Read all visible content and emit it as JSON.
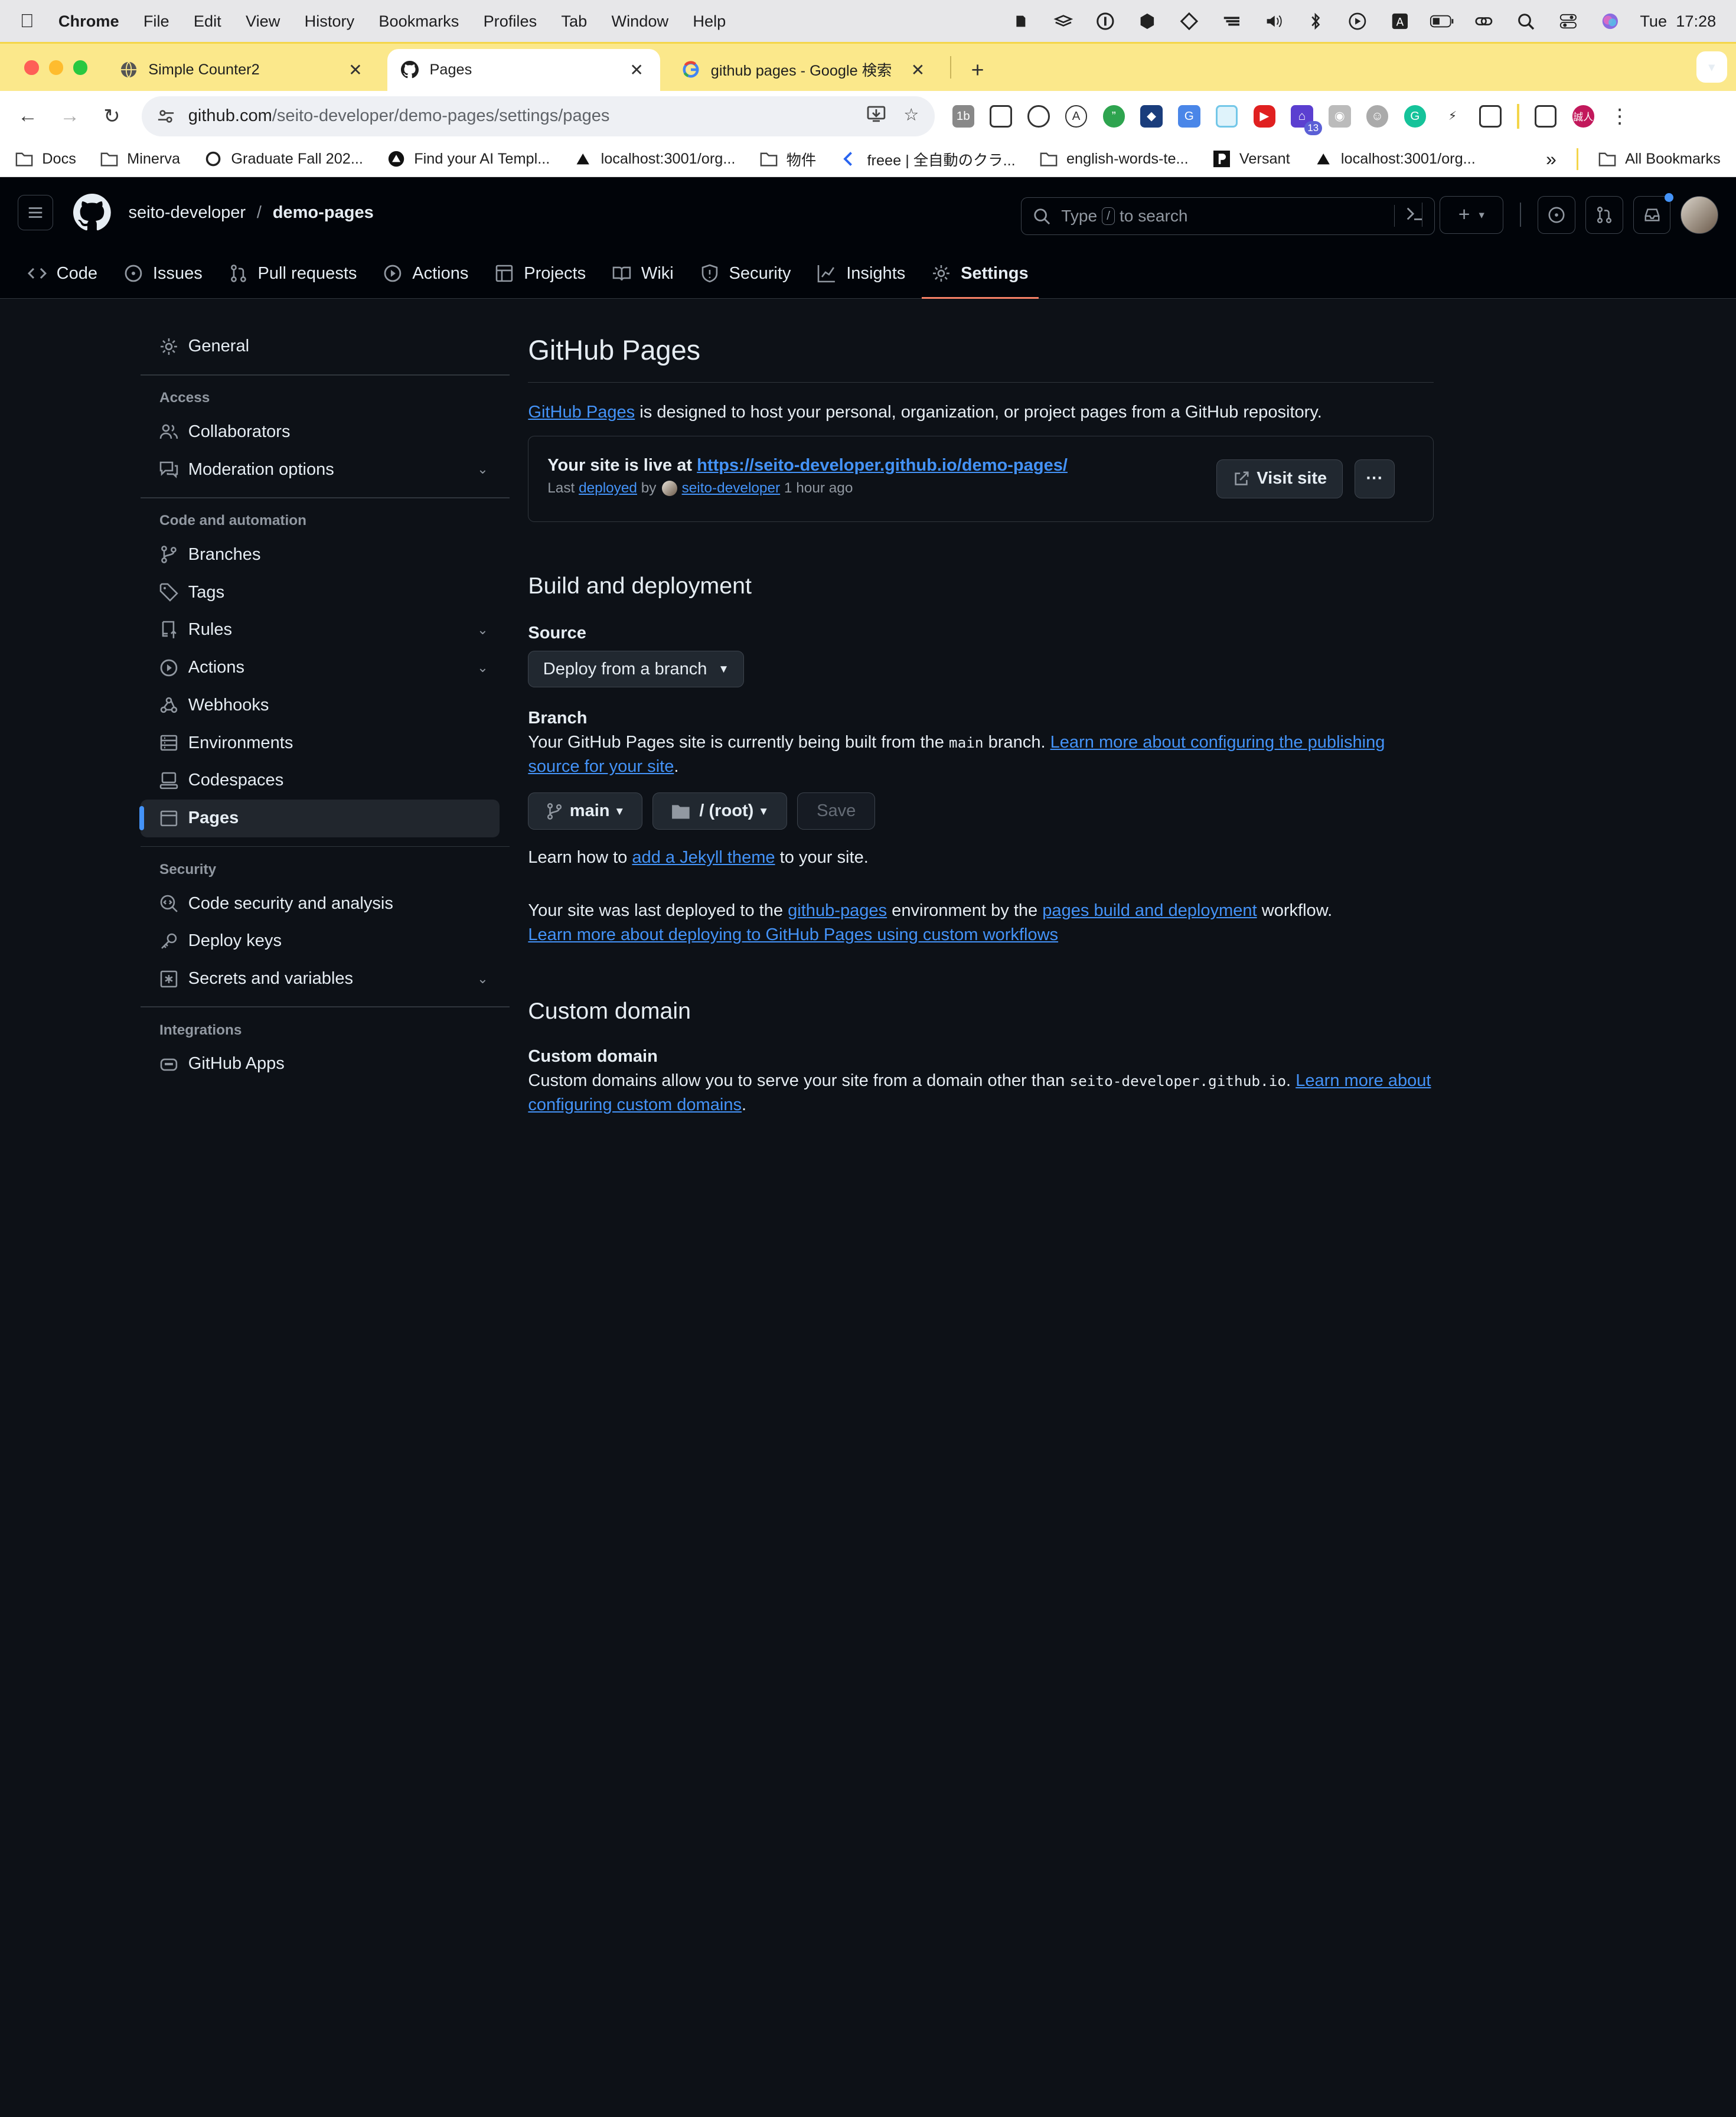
{
  "menubar": {
    "app": "Chrome",
    "items": [
      "File",
      "Edit",
      "View",
      "History",
      "Bookmarks",
      "Profiles",
      "Tab",
      "Window",
      "Help"
    ],
    "clock": "Tue  17:28"
  },
  "tabs": [
    {
      "title": "Simple Counter2",
      "icon": "globe-icon"
    },
    {
      "title": "Pages",
      "icon": "github-icon"
    },
    {
      "title": "github pages - Google 検索",
      "icon": "google-icon"
    }
  ],
  "url": {
    "host": "github.com",
    "path": "/seito-developer/demo-pages/settings/pages"
  },
  "extensions": {
    "badge_count": "13",
    "avatar_text": "誠人"
  },
  "bookmarks": {
    "items": [
      "Docs",
      "Minerva",
      "Graduate Fall 202...",
      "Find your AI Templ...",
      "localhost:3001/org...",
      "物件",
      "freee | 全自動のクラ...",
      "english-words-te...",
      "Versant",
      "localhost:3001/org..."
    ],
    "overflow": "»",
    "all": "All Bookmarks"
  },
  "github": {
    "owner": "seito-developer",
    "separator": "/",
    "repo": "demo-pages",
    "search": {
      "prefix": "Type",
      "key": "/",
      "suffix": "to search"
    },
    "tabs": [
      "Code",
      "Issues",
      "Pull requests",
      "Actions",
      "Projects",
      "Wiki",
      "Security",
      "Insights",
      "Settings"
    ]
  },
  "sidebar": {
    "general": "General",
    "sections": [
      {
        "heading": "Access",
        "items": [
          {
            "label": "Collaborators"
          },
          {
            "label": "Moderation options",
            "expand": true
          }
        ]
      },
      {
        "heading": "Code and automation",
        "items": [
          {
            "label": "Branches"
          },
          {
            "label": "Tags"
          },
          {
            "label": "Rules",
            "expand": true
          },
          {
            "label": "Actions",
            "expand": true
          },
          {
            "label": "Webhooks"
          },
          {
            "label": "Environments"
          },
          {
            "label": "Codespaces"
          },
          {
            "label": "Pages",
            "active": true
          }
        ]
      },
      {
        "heading": "Security",
        "items": [
          {
            "label": "Code security and analysis"
          },
          {
            "label": "Deploy keys"
          },
          {
            "label": "Secrets and variables",
            "expand": true
          }
        ]
      },
      {
        "heading": "Integrations",
        "items": [
          {
            "label": "GitHub Apps"
          }
        ]
      }
    ]
  },
  "pages": {
    "title": "GitHub Pages",
    "intro_link": "GitHub Pages",
    "intro_rest": " is designed to host your personal, organization, or project pages from a GitHub repository.",
    "live": {
      "prefix": "Your site is live at ",
      "url": "https://seito-developer.github.io/demo-pages/",
      "last": "Last ",
      "deployed": "deployed",
      "by": " by",
      "user": "seito-developer",
      "ago": " 1 hour ago",
      "visit": "Visit site",
      "more": "···"
    },
    "build": {
      "heading": "Build and deployment",
      "source_label": "Source",
      "source_value": "Deploy from a branch",
      "branch_label": "Branch",
      "branch_text_1": "Your GitHub Pages site is currently being built from the ",
      "branch_code": "main",
      "branch_text_2": " branch. ",
      "branch_link": "Learn more about configuring the publishing source for your site",
      "branch_end": ".",
      "branch_select": "main",
      "folder_select": "/ (root)",
      "save": "Save",
      "jekyll_pre": "Learn how to ",
      "jekyll_link": "add a Jekyll theme",
      "jekyll_post": " to your site.",
      "deploy_pre": "Your site was last deployed to the ",
      "deploy_env": "github-pages",
      "deploy_mid": " environment by the ",
      "deploy_wf": "pages build and deployment",
      "deploy_post": " workflow.",
      "deploy_learn": "Learn more about deploying to GitHub Pages using custom workflows"
    },
    "custom": {
      "heading": "Custom domain",
      "label": "Custom domain",
      "text_1": "Custom domains allow you to serve your site from a domain other than ",
      "code": "seito-developer.github.io",
      "text_2": ". ",
      "link": "Learn more about configuring custom domains",
      "end": "."
    }
  }
}
